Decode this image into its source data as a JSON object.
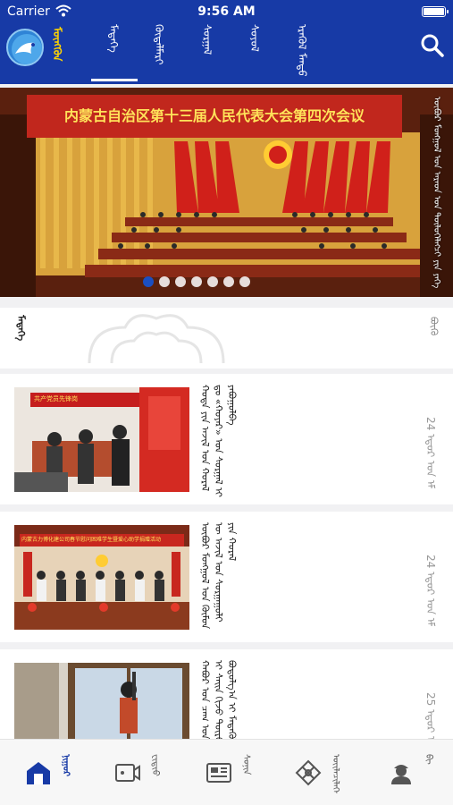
{
  "status_bar": {
    "carrier": "Carrier",
    "time": "9:56 AM"
  },
  "header": {
    "logo_text": "ᠮᠦᠩᠭᠦᠨ",
    "tabs": [
      {
        "label": "ᠮᠡᠳᠡᠭᠡ"
      },
      {
        "label": "ᠬᠥᠳᠡᠯᠮᠡᠷᠢ"
      },
      {
        "label": "ᠰᠤᠷᠭᠠᠯ"
      },
      {
        "label": "ᠰᠤᠶᠤᠯ"
      },
      {
        "label": "ᠡᠷᠡᠭᠦᠯ ᠮᠡᠨᠳᠦ"
      }
    ],
    "active_tab": 0,
    "search_icon": "search-icon"
  },
  "banner": {
    "title": "内蒙古自治区第十三届人民代表大会第四次会议",
    "caption": "ᠥᠪᠦᠷ ᠮᠣᠩᠭᠣᠯ ᠤᠨ ᠠᠷᠠᠳ ᠤᠨ ᠲᠥᠯᠦᠭᠡᠯᠡᠭᠴᠢ ᠶᠢᠨ ᠶᠡᠬᠡ ᠬᠤᠷᠠᠯ",
    "slide_count": 7,
    "active_slide": 0
  },
  "section": {
    "title": "ᠮᠡᠳᠡᠭᠡ",
    "more": "ᠪᠦᠬᠦ"
  },
  "news": [
    {
      "headline": "ᠬᠣᠲᠠ ᠶᠢᠨ ᠠᠵᠢᠯ ᠤᠨ ᠬᠤᠷᠠᠯ ᠳᠤ «ᠬᠣᠶᠠᠷ» ᠤᠨ ᠰᠤᠷᠭᠠᠯ ᠢ ᠶᠠᠪᠤᠭᠤᠯᠪᠠ",
      "date": "24 ᠡᠳᠦᠷ ᠤᠨ ᠡᠮᠦᠨ᠎ᠡ",
      "thumb_caption": "共产党员先锋岗"
    },
    {
      "headline": "ᠥᠪᠦᠷ ᠮᠣᠩᠭᠣᠯ ᠤᠨ ᠬᠦᠮᠦᠨ ᠦ ᠠᠵᠢᠯ ᠤᠨ ᠰᠤᠷᠭᠠᠭᠤᠯᠢ ᠶᠢᠨ ᠬᠤᠷᠠᠯ",
      "date": "24 ᠡᠳᠦᠷ ᠤᠨ ᠡᠮᠦᠨ᠎ᠡ",
      "thumb_caption": "内蒙古力博化建公司春节慰问困难学生暨爱心助学捐赠活动"
    },
    {
      "headline": "ᠬᠠᠪᠤᠷ ᠤᠨ ᠴᠠᠭ ᠤᠨ ᠠᠵᠢᠯ ᠢ ᠰᠠᠢᠨ ᠬᠢᠵᠦ ᠲᠥᠷᠦ ᠶᠢᠨ ᠪᠣᠳᠤᠯᠭ᠎ᠠ ᠢ ᠮᠡᠳᠡᠭᠦᠯᠪᠡ",
      "date": "25 ᠡᠳᠦᠷ ᠤᠨ ᠡᠮᠦᠨ᠎ᠡ",
      "thumb_caption": ""
    }
  ],
  "bottom_nav": [
    {
      "label": "ᠨᠢᠭᠤᠷ",
      "icon": "home-icon"
    },
    {
      "label": "ᠸᠢᠳᠢᠤ",
      "icon": "video-icon"
    },
    {
      "label": "ᠰᠣᠨᠢᠨ",
      "icon": "newspaper-icon"
    },
    {
      "label": "ᠦᠢᠯᠡᠴᠢᠯᠡᠭᠡ",
      "icon": "knot-icon"
    },
    {
      "label": "ᠪᠢ",
      "icon": "user-icon"
    }
  ],
  "colors": {
    "header_bg": "#173aa6",
    "accent": "#1b4fc2",
    "nav_active": "#173aa6",
    "nav_inactive": "#555555"
  }
}
